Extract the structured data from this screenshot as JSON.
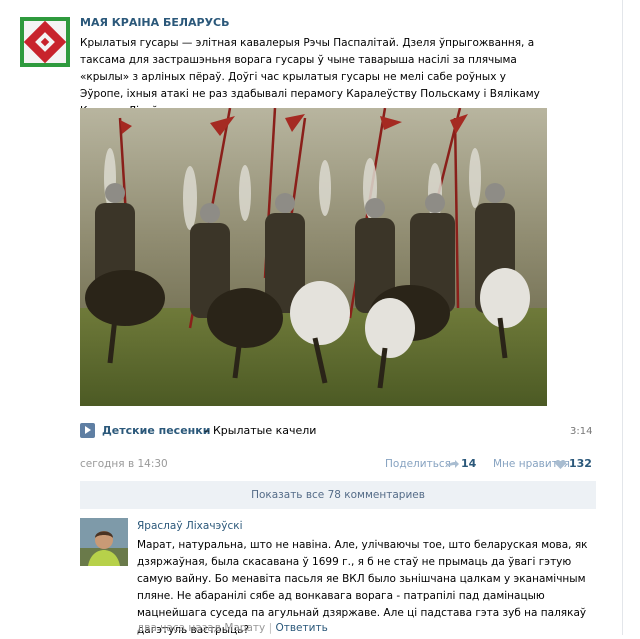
{
  "post": {
    "group_name": "МАЯ КРАІНА БЕЛАРУСЬ",
    "text": "Крылатыя гусары — элітная кавалерыя Рэчы Паспалітай. Дзеля ўпрыгожвання, а таксама для застрашэньня ворага гусары ў чыне тавaрыша насілі за плячыма «крылы» з арлiных пёраў. Доўгі час крылатыя гусары не мелі сабе роўных у Эўропе, іхныя атакі не раз здабывалі перамогу Каралеўству Польскаму і Вялікаму Княству Літоўскаму.",
    "audio": {
      "artist": "Детские песенки",
      "separator": " – ",
      "title": "Крылатые качели",
      "duration": "3:14"
    },
    "date": "сегодня в 14:30",
    "share_label": "Поделиться",
    "share_count": "14",
    "like_label": "Мне нравится",
    "like_count": "132",
    "show_all_comments": "Показать все 78 комментариев"
  },
  "comment": {
    "author": "Яраслаў Ліхачэўскі",
    "text": "Марат, натуральна, што не навіна. Але, улічваючы тое, што беларуская мова, як дзяржаўная, была скасавана ў 1699 г., я б не стаў не прымаць да ўвагі гэтую самую вайну. Бо менавіта пасьля яе ВКЛ было зьнішчана цалкам у эканамічным пляне. Не абаранілі сябе ад вонкавага ворага - патрапілі пад дамінацыю мацнейшага суседа па агульнай дзяржаве. Але ці падстава гэта зуб на палякаў дагэтуль вастрыць?",
    "time": "два часа назад Марату",
    "separator": "|",
    "reply_label": "Ответить"
  },
  "colors": {
    "link": "#2b587a",
    "muted": "#999999",
    "panel": "#edf1f5"
  }
}
